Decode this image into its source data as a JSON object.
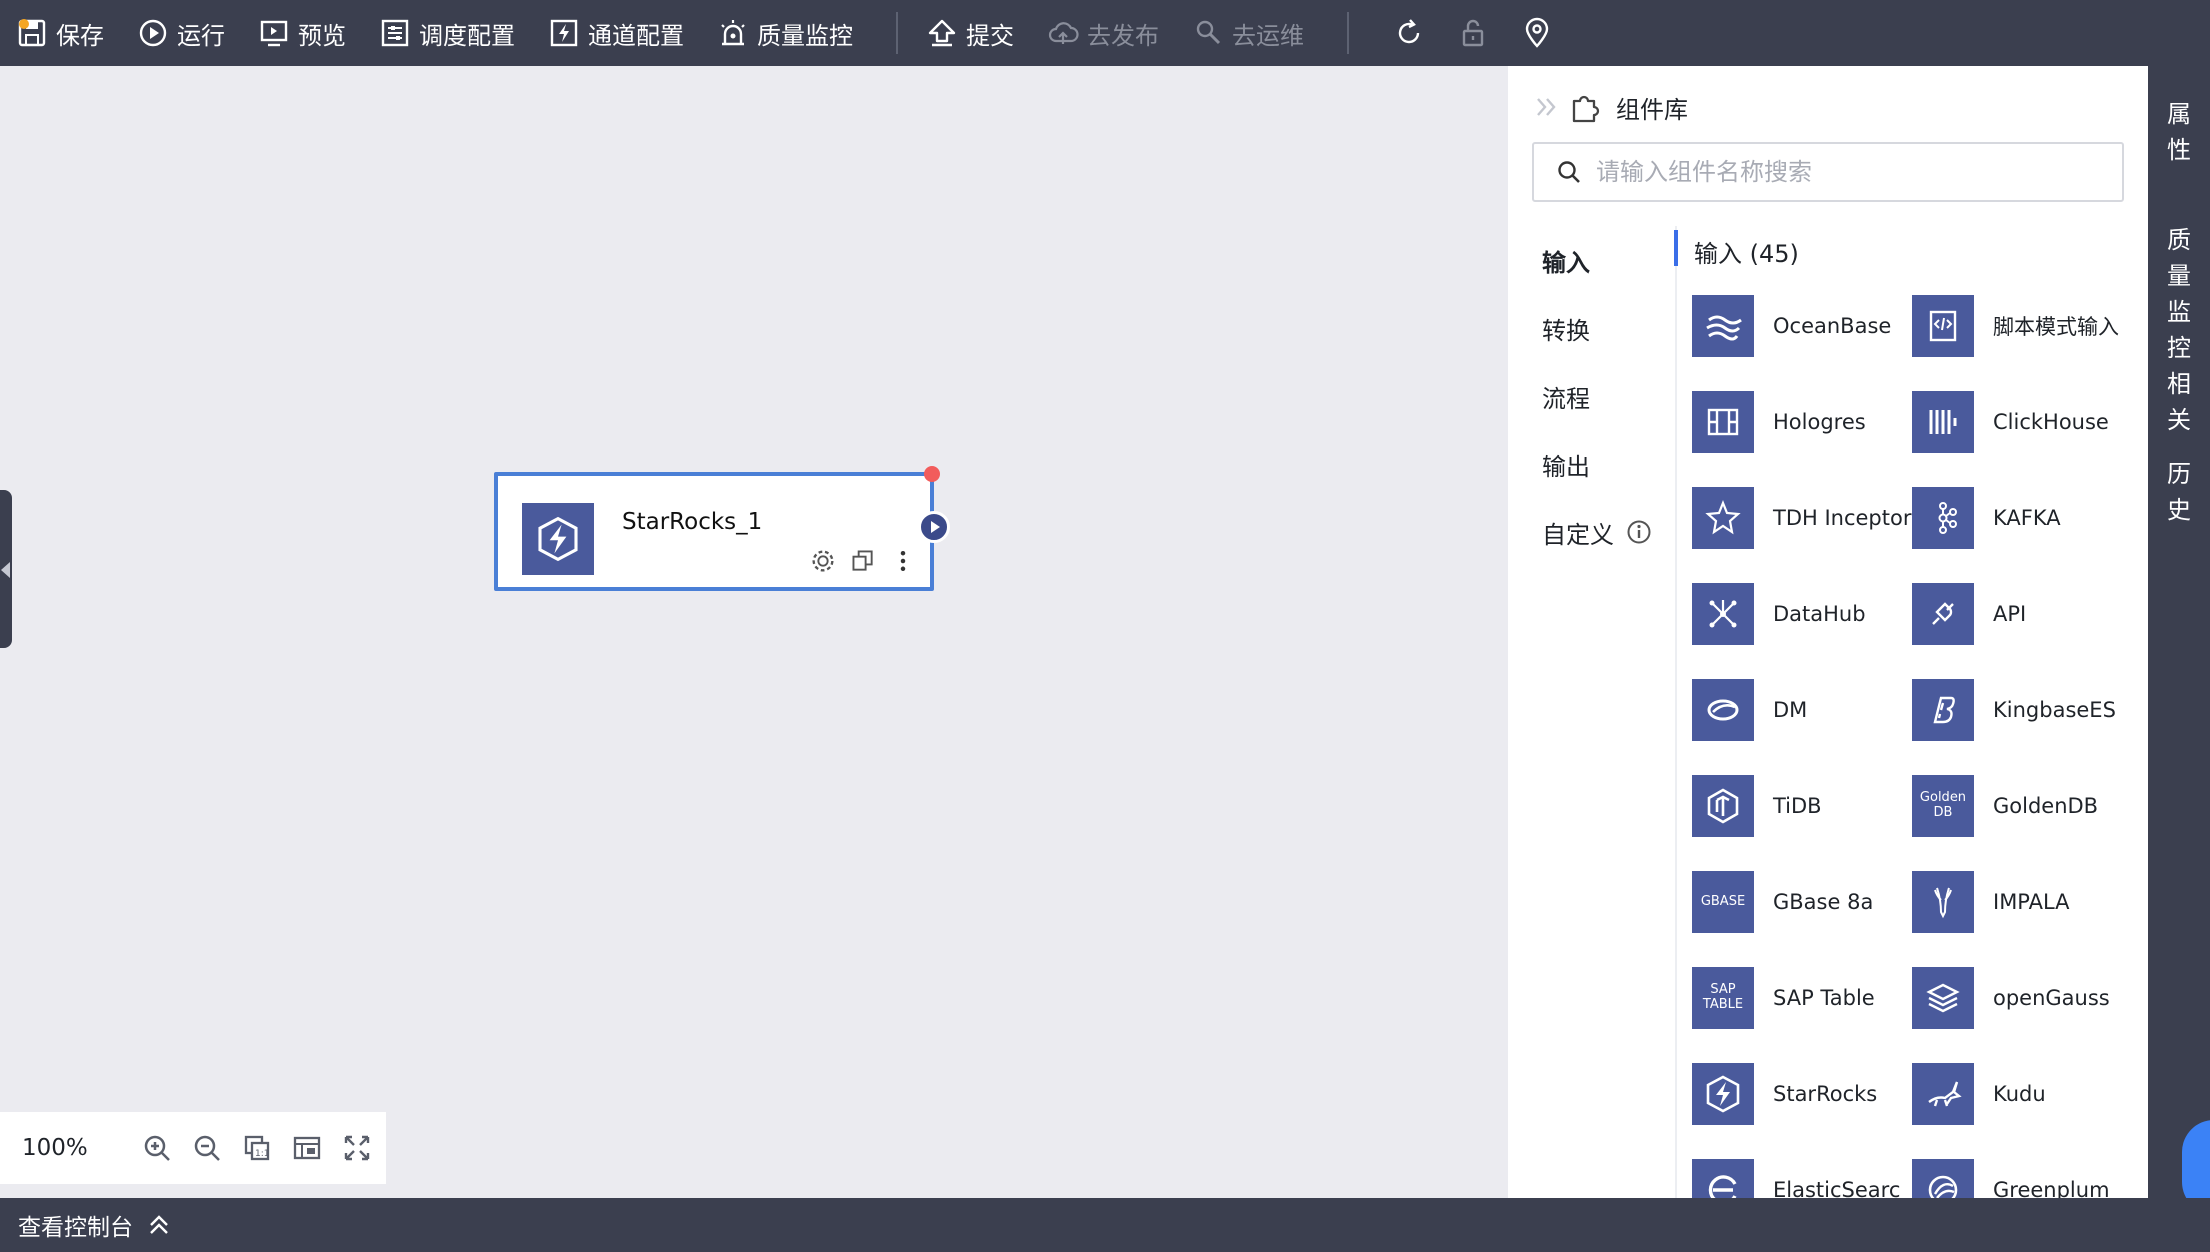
{
  "toolbar": {
    "save": "保存",
    "run": "运行",
    "preview": "预览",
    "schedule_config": "调度配置",
    "channel_config": "通道配置",
    "quality_monitor": "质量监控",
    "submit": "提交",
    "publish": "去发布",
    "ops": "去运维"
  },
  "canvas": {
    "node": {
      "title": "StarRocks_1"
    },
    "zoom": "100%"
  },
  "library": {
    "title": "组件库",
    "search_placeholder": "请输入组件名称搜索",
    "categories": [
      "输入",
      "转换",
      "流程",
      "输出",
      "自定义"
    ],
    "list_heading": "输入 (45)",
    "components": [
      {
        "name": "OceanBase",
        "icon": "oceanbase-icon"
      },
      {
        "name": "脚本模式输入",
        "icon": "script-icon"
      },
      {
        "name": "Hologres",
        "icon": "hologres-icon"
      },
      {
        "name": "ClickHouse",
        "icon": "clickhouse-icon"
      },
      {
        "name": "TDH Inceptor",
        "icon": "star-icon"
      },
      {
        "name": "KAFKA",
        "icon": "kafka-icon"
      },
      {
        "name": "DataHub",
        "icon": "datahub-icon"
      },
      {
        "name": "API",
        "icon": "plug-icon"
      },
      {
        "name": "DM",
        "icon": "dm-icon"
      },
      {
        "name": "KingbaseES",
        "icon": "kingbase-icon"
      },
      {
        "name": "TiDB",
        "icon": "tidb-icon"
      },
      {
        "name": "GoldenDB",
        "icon": "goldendb-icon",
        "badge": "Golden DB"
      },
      {
        "name": "GBase 8a",
        "icon": "gbase-icon",
        "badge": "GBASE"
      },
      {
        "name": "IMPALA",
        "icon": "impala-icon"
      },
      {
        "name": "SAP Table",
        "icon": "sap-icon",
        "badge": "SAP TABLE"
      },
      {
        "name": "openGauss",
        "icon": "opengauss-icon"
      },
      {
        "name": "StarRocks",
        "icon": "starrocks-icon"
      },
      {
        "name": "Kudu",
        "icon": "kudu-icon"
      },
      {
        "name": "ElasticSearc",
        "icon": "elasticsearch-icon"
      },
      {
        "name": "Greenplum",
        "icon": "greenplum-icon"
      }
    ]
  },
  "rail": {
    "tabs": [
      "属性",
      "质量监控",
      "相关",
      "历史"
    ]
  },
  "console": {
    "label": "查看控制台"
  },
  "colors": {
    "toolbar_bg": "#3b3f4f",
    "canvas_bg": "#ebebf0",
    "component_icon_bg": "#4a5a9c",
    "accent": "#3a6ee8",
    "node_border": "#4a7fd6"
  }
}
